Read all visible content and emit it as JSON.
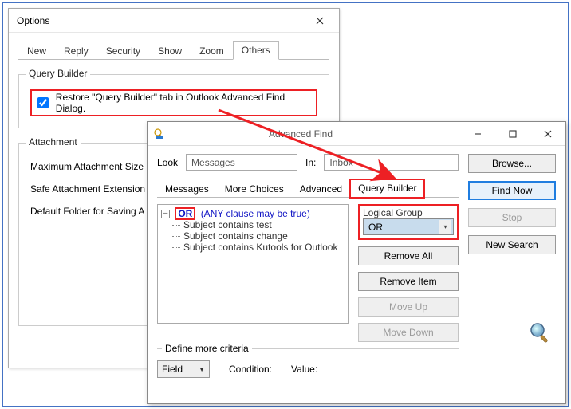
{
  "options": {
    "title": "Options",
    "tabs": {
      "new": "New",
      "reply": "Reply",
      "security": "Security",
      "show": "Show",
      "zoom": "Zoom",
      "others": "Others"
    },
    "qb_legend": "Query Builder",
    "restore_label": "Restore \"Query Builder\" tab in Outlook Advanced Find Dialog.",
    "attach_legend": "Attachment",
    "attach_row1": "Maximum Attachment Size",
    "attach_row2": "Safe Attachment Extension",
    "attach_row3": "Default Folder for Saving A"
  },
  "af": {
    "title": "Advanced Find",
    "look_label": "Look",
    "look_value": "Messages",
    "in_label": "In:",
    "in_value": "Inbox",
    "browse": "Browse...",
    "find_now": "Find Now",
    "stop": "Stop",
    "new_search": "New Search",
    "tabs": {
      "messages": "Messages",
      "more": "More Choices",
      "advanced": "Advanced",
      "qb": "Query Builder"
    },
    "tree_or": "OR",
    "tree_hint": "(ANY clause may be true)",
    "clauses": [
      "Subject contains test",
      "Subject contains change",
      "Subject contains Kutools for Outlook"
    ],
    "logical_group_label": "Logical Group",
    "logical_group_value": "OR",
    "remove_all": "Remove All",
    "remove_item": "Remove Item",
    "move_up": "Move Up",
    "move_down": "Move Down",
    "define_legend": "Define more criteria",
    "field_btn": "Field",
    "condition_label": "Condition:",
    "value_label": "Value:"
  }
}
